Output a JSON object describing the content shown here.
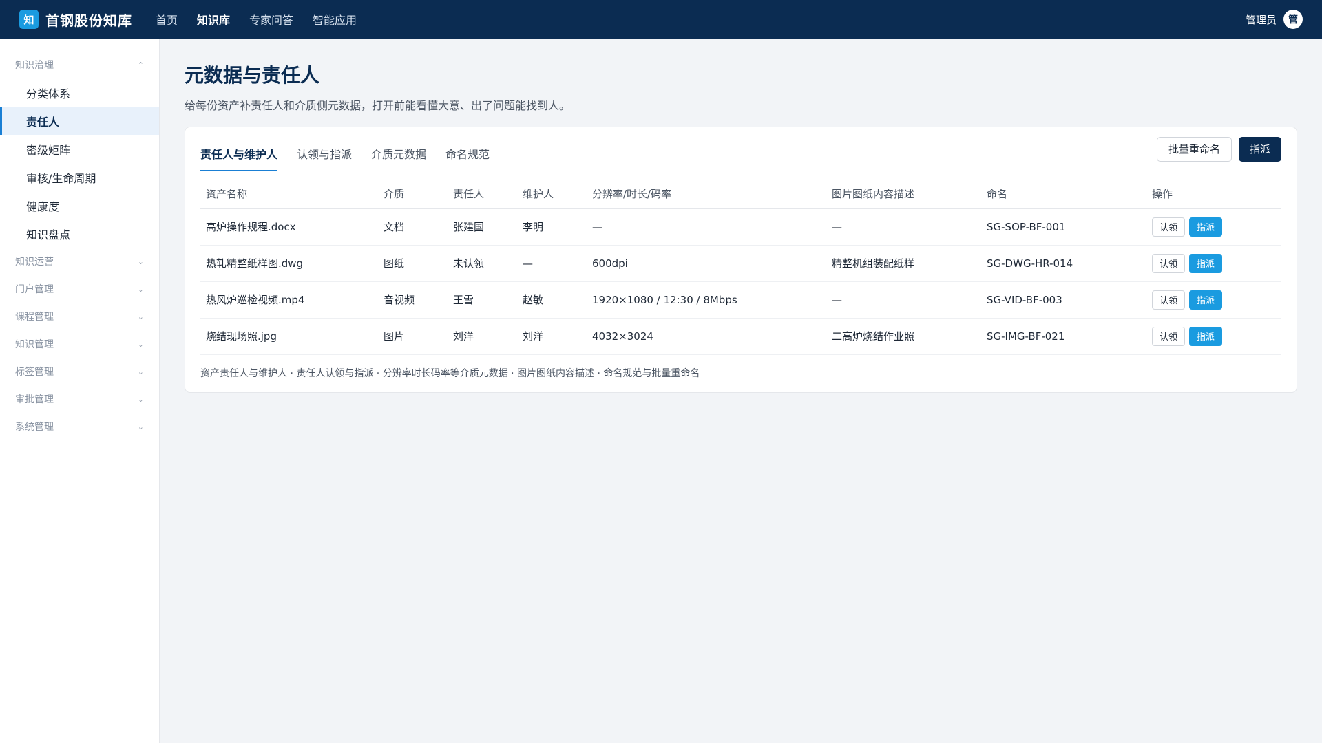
{
  "brand": {
    "logo": "知",
    "name": "首钢股份知库"
  },
  "topnav": [
    "首页",
    "知识库",
    "专家问答",
    "智能应用"
  ],
  "topnav_active": 1,
  "user": {
    "name": "管理员",
    "avatar": "管"
  },
  "sidebar": {
    "groups": [
      {
        "label": "知识治理",
        "expanded": true,
        "items": [
          "分类体系",
          "责任人",
          "密级矩阵",
          "审核/生命周期",
          "健康度",
          "知识盘点"
        ]
      },
      {
        "label": "知识运营",
        "expanded": false
      },
      {
        "label": "门户管理",
        "expanded": false
      },
      {
        "label": "课程管理",
        "expanded": false
      },
      {
        "label": "知识管理",
        "expanded": false
      },
      {
        "label": "标签管理",
        "expanded": false
      },
      {
        "label": "审批管理",
        "expanded": false
      },
      {
        "label": "系统管理",
        "expanded": false
      }
    ],
    "active_item": "责任人"
  },
  "page": {
    "title": "元数据与责任人",
    "subtitle": "给每份资产补责任人和介质侧元数据，打开前能看懂大意、出了问题能找到人。"
  },
  "tabs": [
    "责任人与维护人",
    "认领与指派",
    "介质元数据",
    "命名规范"
  ],
  "active_tab": 0,
  "actions": {
    "batch_rename": "批量重命名",
    "assign": "指派"
  },
  "table": {
    "headers": [
      "资产名称",
      "介质",
      "责任人",
      "维护人",
      "分辨率/时长/码率",
      "图片图纸内容描述",
      "命名",
      "操作"
    ],
    "rows": [
      [
        "高炉操作规程.docx",
        "文档",
        "张建国",
        "李明",
        "—",
        "—",
        "SG-SOP-BF-001"
      ],
      [
        "热轧精整纸样图.dwg",
        "图纸",
        "未认领",
        "—",
        "600dpi",
        "精整机组装配纸样",
        "SG-DWG-HR-014"
      ],
      [
        "热风炉巡检视频.mp4",
        "音视频",
        "王雪",
        "赵敏",
        "1920×1080 / 12:30 / 8Mbps",
        "—",
        "SG-VID-BF-003"
      ],
      [
        "烧结现场照.jpg",
        "图片",
        "刘洋",
        "刘洋",
        "4032×3024",
        "二高炉烧结作业照",
        "SG-IMG-BF-021"
      ]
    ],
    "row_actions": {
      "claim": "认领",
      "assign": "指派"
    }
  },
  "footnote": "资产责任人与维护人 · 责任人认领与指派 · 分辨率时长码率等介质元数据 · 图片图纸内容描述 · 命名规范与批量重命名",
  "colors": {
    "topbar": "#0b2c52",
    "accent": "#1a9be0",
    "active_tab": "#1a7fd4"
  },
  "icons": {
    "expanded": "chevron-up-icon",
    "collapsed": "chevron-down-icon"
  }
}
